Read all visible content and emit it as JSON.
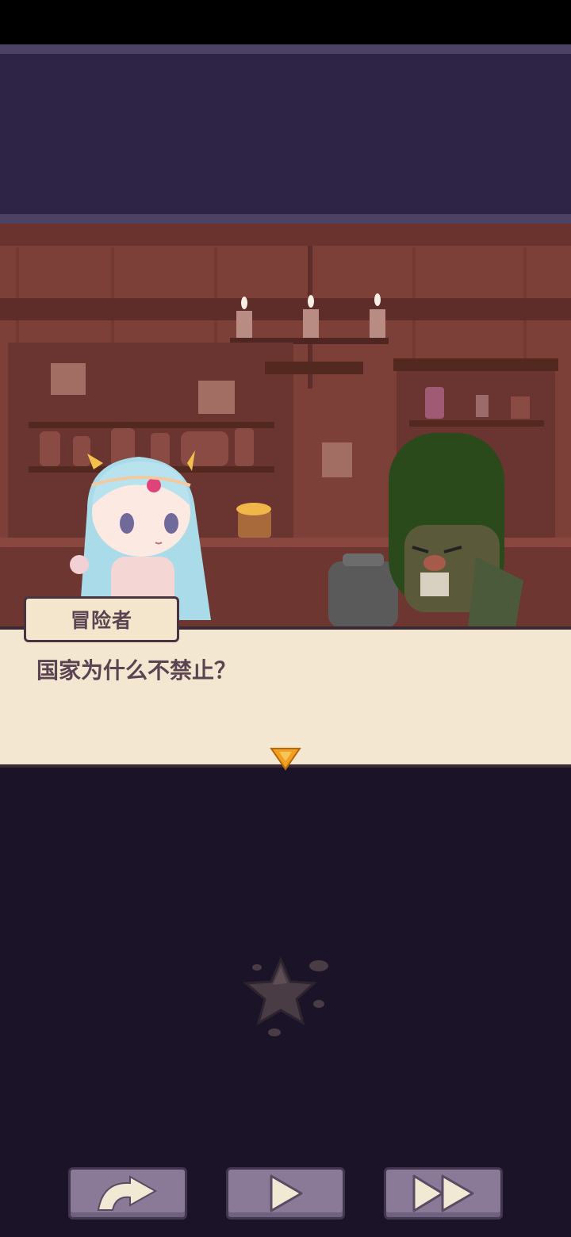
{
  "dialog": {
    "speaker": "冒险者",
    "line": "国家为什么不禁止？"
  },
  "controls": {
    "skip_icon": "curved-arrow-icon",
    "play_icon": "play-icon",
    "fast_forward_icon": "fast-forward-icon"
  },
  "colors": {
    "panel": "#2e2446",
    "dialog_bg": "#f3e7d1",
    "button": "#8b7a97",
    "accent": "#f0a020"
  }
}
